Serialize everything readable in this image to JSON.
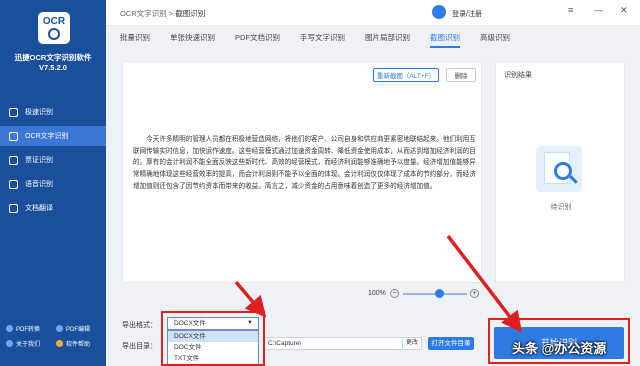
{
  "sidebar": {
    "logo_text": "OCR",
    "app_name": "迅捷OCR文字识别软件",
    "version": "V7.5.2.0",
    "nav": [
      {
        "label": "极速识别",
        "icon": "lightning-icon"
      },
      {
        "label": "OCR文字识别",
        "icon": "ocr-icon"
      },
      {
        "label": "票证识别",
        "icon": "ticket-icon"
      },
      {
        "label": "语音识别",
        "icon": "mic-icon"
      },
      {
        "label": "文档翻译",
        "icon": "translate-icon"
      }
    ],
    "links": [
      {
        "label": "PDF转换"
      },
      {
        "label": "PDF编辑"
      },
      {
        "label": "关于我们"
      },
      {
        "label": "软件帮助"
      }
    ]
  },
  "topbar": {
    "crumb_root": "OCR文字识别",
    "crumb_sep": ">",
    "crumb_current": "截图识别",
    "login": "登录/注册",
    "win_menu": "≡",
    "win_min": "—",
    "win_close": "✕"
  },
  "tabs": [
    "批量识别",
    "单张快速识别",
    "PDF文档识别",
    "手写文字识别",
    "图片局部识别",
    "截图识别",
    "高级识别"
  ],
  "active_tab": "截图识别",
  "left_panel": {
    "new_screenshot": "重新截图（ALT+F）",
    "delete": "删除",
    "text": "今天许多精明的管理人员都在积极地营造网络，将他们的客户、公司自身和供应商更紧密地联结起来。他们利用互联网传输实时信息，加快运作速度。这些经营模式通过加速资金周转、降低资金使用成本，从而达到增加经济利润的目的。厚有的会计利润不能全面反映这些新时代、高效的经营模式，而经济利润能够准确地予以度量。经济增加值能够异常精确地体现这些经营效率的提高，而会计利润则不能予以全面的体现。会计利润仅仅体现了成本的节约部分，而经济增加值则还包含了因节约资本而带来的收益。简言之，减少资金的占用意味着创造了更多的经济增加值。"
  },
  "zoom": {
    "percent": "100%",
    "minus": "−",
    "plus": "+",
    "level": 0.5
  },
  "right_panel": {
    "title": "识别结果",
    "waiting": "待识别"
  },
  "bottom": {
    "format_label": "导出格式：",
    "format_value": "DOCX文件",
    "format_options": [
      "DOCX文件",
      "DOC文件",
      "TXT文件"
    ],
    "dir_label": "导出目录：",
    "dir_value": "C:\\Capture\\",
    "change_btn": "更改",
    "open_btn": "打开文件目录",
    "start_btn": "开始识别"
  },
  "watermark": "头条 @办公资源"
}
